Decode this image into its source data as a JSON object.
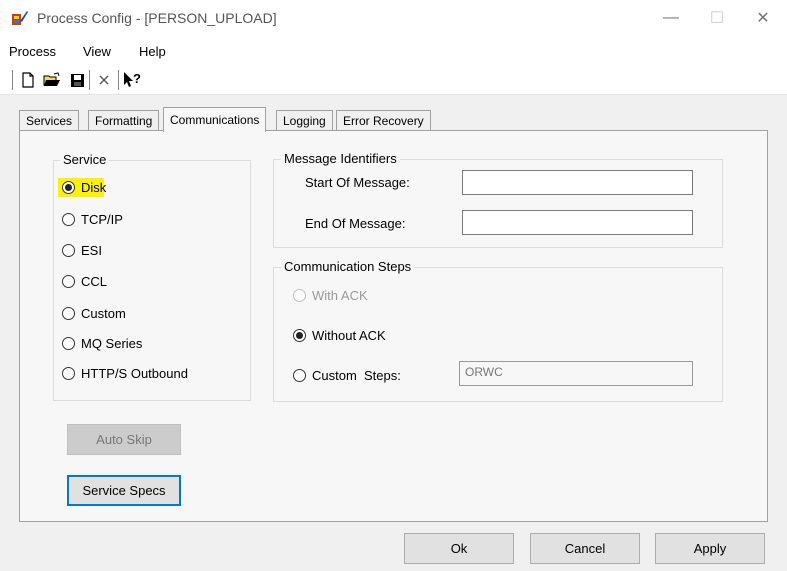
{
  "window": {
    "title": "Process Config - [PERSON_UPLOAD]",
    "icon": "process-config-app-icon",
    "minimize_glyph": "—",
    "maximize_glyph": "☐",
    "close_glyph": "✕"
  },
  "menu": {
    "items": [
      {
        "label": "Process"
      },
      {
        "label": "View"
      },
      {
        "label": "Help"
      }
    ]
  },
  "toolbar": {
    "icons": [
      "new-file-icon",
      "open-folder-icon",
      "save-icon",
      "delete-icon",
      "context-help-icon"
    ]
  },
  "tabs": [
    {
      "label": "Services",
      "active": false
    },
    {
      "label": "Formatting",
      "active": false
    },
    {
      "label": "Communications",
      "active": true
    },
    {
      "label": "Logging",
      "active": false
    },
    {
      "label": "Error Recovery",
      "active": false
    }
  ],
  "service_group": {
    "label": "Service",
    "options": [
      {
        "label": "Disk",
        "selected": true,
        "highlight": "#fff200"
      },
      {
        "label": "TCP/IP",
        "selected": false
      },
      {
        "label": "ESI",
        "selected": false
      },
      {
        "label": "CCL",
        "selected": false
      },
      {
        "label": "Custom",
        "selected": false
      },
      {
        "label": "MQ Series",
        "selected": false
      },
      {
        "label": "HTTP/S Outbound",
        "selected": false
      }
    ]
  },
  "message_identifiers": {
    "label": "Message Identifiers",
    "start_label": "Start Of Message:",
    "start_value": "",
    "end_label": "End Of Message:",
    "end_value": ""
  },
  "communication_steps": {
    "label": "Communication Steps",
    "with_ack_label": "With ACK",
    "without_ack_label": "Without ACK",
    "custom_steps_label": "Custom  Steps:",
    "custom_steps_value": "ORWC"
  },
  "buttons": {
    "auto_skip": "Auto Skip",
    "service_specs": "Service Specs",
    "ok": "Ok",
    "cancel": "Cancel",
    "apply": "Apply"
  }
}
